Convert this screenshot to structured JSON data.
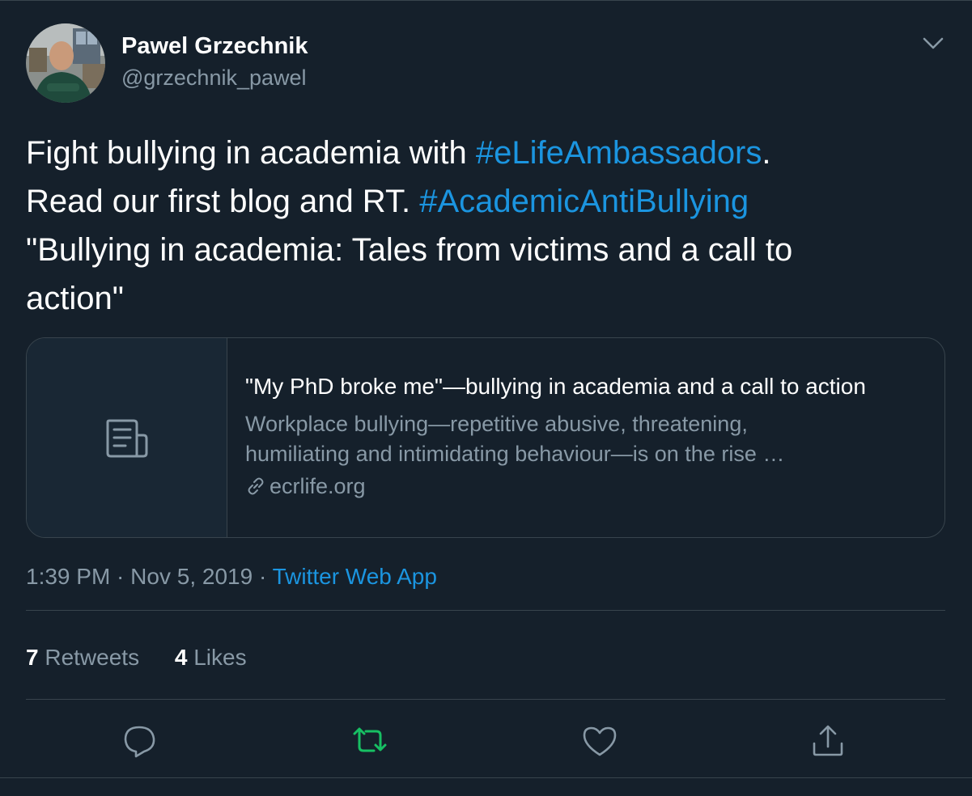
{
  "author": {
    "name": "Pawel Grzechnik",
    "handle": "@grzechnik_pawel"
  },
  "tweet": {
    "line1_text": "Fight bullying in academia with ",
    "line1_hashtag": "#eLifeAmbassadors",
    "line1_end": ".",
    "line2_text": "Read our first blog and RT. ",
    "line2_hashtag": "#AcademicAntiBullying",
    "line3": "\"Bullying in academia: Tales from victims and a call to",
    "line4": "action\""
  },
  "card": {
    "title": "\"My PhD broke me\"—bullying in academia and a call to action",
    "description_line1": "Workplace bullying—repetitive abusive, threatening,",
    "description_line2": "humiliating and intimidating behaviour—is on the rise …",
    "domain": "ecrlife.org",
    "thumbnail_icon": "document-icon"
  },
  "meta": {
    "time": "1:39 PM",
    "date": "Nov 5, 2019",
    "separator": " · ",
    "source": "Twitter Web App"
  },
  "stats": {
    "retweets_count": "7",
    "retweets_label": "Retweets",
    "likes_count": "4",
    "likes_label": "Likes"
  },
  "actions": [
    "reply-icon",
    "retweet-icon",
    "like-icon",
    "share-icon"
  ],
  "colors": {
    "background": "#15202b",
    "link": "#1b95e0",
    "secondary_text": "#8899a6",
    "border": "#38444d",
    "retweet_active": "#17bf63"
  }
}
